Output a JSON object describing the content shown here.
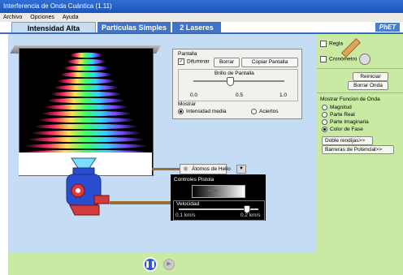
{
  "window": {
    "title": "Interferencia de Onda Cuántica (1.11)"
  },
  "menu": {
    "items": [
      "Archivo",
      "Opciones",
      "Ayuda"
    ]
  },
  "tabs": [
    {
      "label": "Intensidad Alta",
      "selected": true
    },
    {
      "label": "Partículas Simples",
      "selected": false
    },
    {
      "label": "2 Laseres",
      "selected": false
    }
  ],
  "brand": {
    "logo_text": "PhET"
  },
  "pantalla": {
    "title": "Pantalla",
    "difuminar_label": "Difuminar",
    "difuminar_checked": true,
    "borrar_label": "Borrar",
    "copiar_label": "Copiar Pantalla",
    "brillo_label": "Brillo de Pantalla",
    "brillo_value": 0.4,
    "ticks": [
      "0.0",
      "0.5",
      "1.0"
    ],
    "mostrar_label": "Mostrar",
    "mostrar_options": [
      "Intensidad media",
      "Aciertos"
    ],
    "mostrar_selected": "Intensidad media"
  },
  "source": {
    "particle_select": "Átomos de Helio",
    "controls_title": "Controles Pistola",
    "velocity_label": "Velocidad",
    "velocity_min": "0.1 km/s",
    "velocity_max": "0.2 km/s",
    "velocity_value": 0.85
  },
  "right_panel": {
    "regla_label": "Regla",
    "cronometro_label": "Cronómetro",
    "reiniciar_label": "Reiniciar",
    "borrar_onda_label": "Borrar Onda",
    "mostrar_funcion_title": "Mostrar Funcion de Onda",
    "funcion_options": [
      "Magnitud",
      "Parte Real",
      "Parte Imaginaria",
      "Color de Fase"
    ],
    "funcion_selected": "Color de Fase",
    "doble_rendija_label": "Doble rendijas>>",
    "barreras_label": "Barreras de Potencial>>"
  },
  "playback": {
    "pause_icon": "pause-icon",
    "step_icon": "step-icon"
  },
  "colors": {
    "play_area": "#c5dcf5",
    "side_panel": "#c9eaa2",
    "tab_active": "#c9dcf2",
    "tab_inactive": "#3f74c8"
  }
}
